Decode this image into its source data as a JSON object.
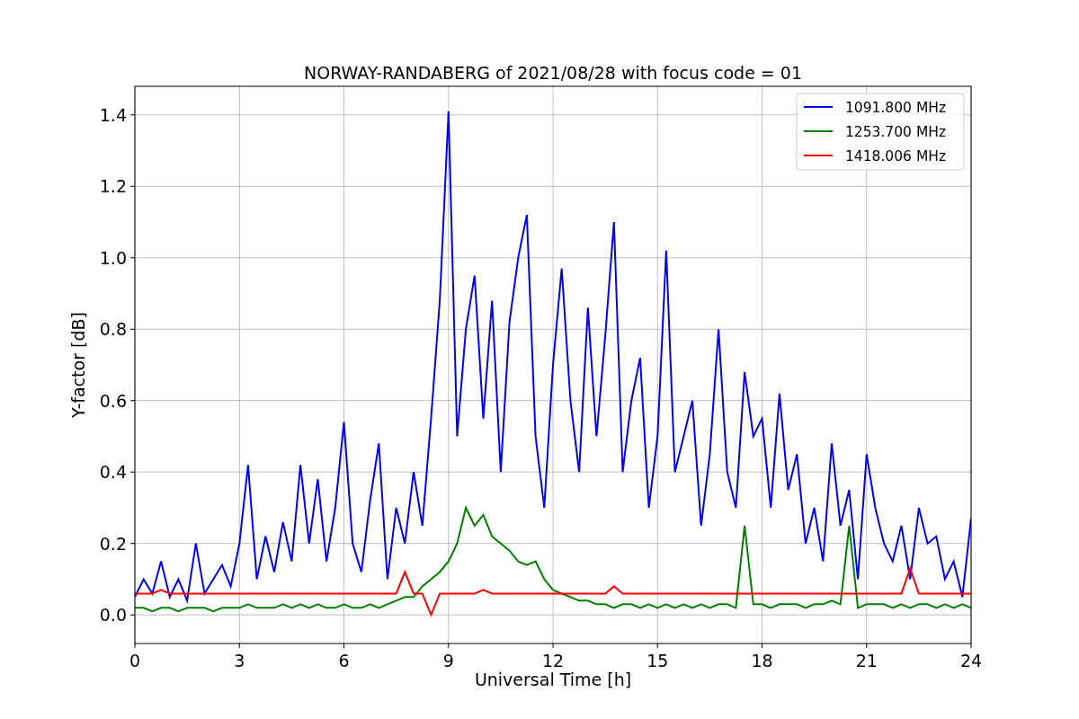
{
  "figure": {
    "chart_data": {
      "type": "line",
      "title": "NORWAY-RANDABERG of 2021/08/28 with focus code = 01",
      "xlabel": "Universal Time [h]",
      "ylabel": "Y-factor [dB]",
      "x": [
        0,
        0.25,
        0.5,
        0.75,
        1,
        1.25,
        1.5,
        1.75,
        2,
        2.25,
        2.5,
        2.75,
        3,
        3.25,
        3.5,
        3.75,
        4,
        4.25,
        4.5,
        4.75,
        5,
        5.25,
        5.5,
        5.75,
        6,
        6.25,
        6.5,
        6.75,
        7,
        7.25,
        7.5,
        7.75,
        8,
        8.25,
        8.5,
        8.75,
        9,
        9.25,
        9.5,
        9.75,
        10,
        10.25,
        10.5,
        10.75,
        11,
        11.25,
        11.5,
        11.75,
        12,
        12.25,
        12.5,
        12.75,
        13,
        13.25,
        13.5,
        13.75,
        14,
        14.25,
        14.5,
        14.75,
        15,
        15.25,
        15.5,
        15.75,
        16,
        16.25,
        16.5,
        16.75,
        17,
        17.25,
        17.5,
        17.75,
        18,
        18.25,
        18.5,
        18.75,
        19,
        19.25,
        19.5,
        19.75,
        20,
        20.25,
        20.5,
        20.75,
        21,
        21.25,
        21.5,
        21.75,
        22,
        22.25,
        22.5,
        22.75,
        23,
        23.25,
        23.5,
        23.75,
        24
      ],
      "series": [
        {
          "name": "1091.800 MHz",
          "color": "#0000ff",
          "values": [
            0.05,
            0.1,
            0.06,
            0.15,
            0.05,
            0.1,
            0.04,
            0.2,
            0.06,
            0.1,
            0.14,
            0.08,
            0.2,
            0.42,
            0.1,
            0.22,
            0.12,
            0.26,
            0.15,
            0.42,
            0.2,
            0.38,
            0.15,
            0.3,
            0.54,
            0.2,
            0.12,
            0.32,
            0.48,
            0.1,
            0.3,
            0.2,
            0.4,
            0.25,
            0.55,
            0.88,
            1.41,
            0.5,
            0.8,
            0.95,
            0.55,
            0.88,
            0.4,
            0.82,
            1.0,
            1.12,
            0.5,
            0.3,
            0.7,
            0.97,
            0.6,
            0.4,
            0.86,
            0.5,
            0.78,
            1.1,
            0.4,
            0.6,
            0.72,
            0.3,
            0.5,
            1.02,
            0.4,
            0.5,
            0.6,
            0.25,
            0.45,
            0.8,
            0.4,
            0.3,
            0.68,
            0.5,
            0.55,
            0.3,
            0.62,
            0.35,
            0.45,
            0.2,
            0.3,
            0.15,
            0.48,
            0.25,
            0.35,
            0.1,
            0.45,
            0.3,
            0.2,
            0.15,
            0.25,
            0.1,
            0.3,
            0.2,
            0.22,
            0.1,
            0.15,
            0.05,
            0.27
          ]
        },
        {
          "name": "1253.700 MHz",
          "color": "#008000",
          "values": [
            0.02,
            0.02,
            0.01,
            0.02,
            0.02,
            0.01,
            0.02,
            0.02,
            0.02,
            0.01,
            0.02,
            0.02,
            0.02,
            0.03,
            0.02,
            0.02,
            0.02,
            0.03,
            0.02,
            0.03,
            0.02,
            0.03,
            0.02,
            0.02,
            0.03,
            0.02,
            0.02,
            0.03,
            0.02,
            0.03,
            0.04,
            0.05,
            0.05,
            0.08,
            0.1,
            0.12,
            0.15,
            0.2,
            0.3,
            0.25,
            0.28,
            0.22,
            0.2,
            0.18,
            0.15,
            0.14,
            0.15,
            0.1,
            0.07,
            0.06,
            0.05,
            0.04,
            0.04,
            0.03,
            0.03,
            0.02,
            0.03,
            0.03,
            0.02,
            0.03,
            0.02,
            0.03,
            0.02,
            0.03,
            0.02,
            0.03,
            0.02,
            0.03,
            0.03,
            0.02,
            0.25,
            0.03,
            0.03,
            0.02,
            0.03,
            0.03,
            0.03,
            0.02,
            0.03,
            0.03,
            0.04,
            0.03,
            0.25,
            0.02,
            0.03,
            0.03,
            0.03,
            0.02,
            0.03,
            0.02,
            0.03,
            0.03,
            0.02,
            0.03,
            0.02,
            0.03,
            0.02
          ]
        },
        {
          "name": "1418.006 MHz",
          "color": "#ff0000",
          "values": [
            0.06,
            0.06,
            0.06,
            0.07,
            0.06,
            0.06,
            0.06,
            0.06,
            0.06,
            0.06,
            0.06,
            0.06,
            0.06,
            0.06,
            0.06,
            0.06,
            0.06,
            0.06,
            0.06,
            0.06,
            0.06,
            0.06,
            0.06,
            0.06,
            0.06,
            0.06,
            0.06,
            0.06,
            0.06,
            0.06,
            0.06,
            0.12,
            0.06,
            0.06,
            0.0,
            0.06,
            0.06,
            0.06,
            0.06,
            0.06,
            0.07,
            0.06,
            0.06,
            0.06,
            0.06,
            0.06,
            0.06,
            0.06,
            0.06,
            0.06,
            0.06,
            0.06,
            0.06,
            0.06,
            0.06,
            0.08,
            0.06,
            0.06,
            0.06,
            0.06,
            0.06,
            0.06,
            0.06,
            0.06,
            0.06,
            0.06,
            0.06,
            0.06,
            0.06,
            0.06,
            0.06,
            0.06,
            0.06,
            0.06,
            0.06,
            0.06,
            0.06,
            0.06,
            0.06,
            0.06,
            0.06,
            0.06,
            0.06,
            0.06,
            0.06,
            0.06,
            0.06,
            0.06,
            0.06,
            0.13,
            0.06,
            0.06,
            0.06,
            0.06,
            0.06,
            0.06,
            0.06
          ]
        }
      ],
      "grid": true,
      "legend": true,
      "xlim": [
        0,
        24
      ],
      "ylim": [
        -0.08,
        1.48
      ],
      "xticks": [
        0,
        3,
        6,
        9,
        12,
        15,
        18,
        21,
        24
      ],
      "yticks": [
        {
          "value": 0,
          "label": "0.0"
        },
        {
          "value": 0.2,
          "label": "0.2"
        },
        {
          "value": 0.4,
          "label": "0.4"
        },
        {
          "value": 0.6,
          "label": "0.6"
        },
        {
          "value": 0.8,
          "label": "0.8"
        },
        {
          "value": 1.0,
          "label": "1.0"
        },
        {
          "value": 1.2,
          "label": "1.2"
        },
        {
          "value": 1.4,
          "label": "1.4"
        }
      ]
    }
  }
}
